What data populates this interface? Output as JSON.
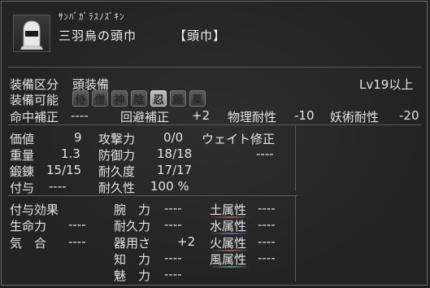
{
  "item": {
    "reading": "ｻﾝﾊﾞｶﾞﾗｽﾉｽﾞｷﾝ",
    "name": "三羽烏の頭巾",
    "category_tag": "【頭巾】",
    "icon": "hood-icon"
  },
  "equip": {
    "slot_label": "装備区分",
    "slot_value": "頭装備",
    "level_req": "Lv19以上",
    "usable_label": "装備可能",
    "classes": [
      {
        "label": "侍",
        "active": false
      },
      {
        "label": "僧",
        "active": false
      },
      {
        "label": "神",
        "active": false
      },
      {
        "label": "陰",
        "active": false
      },
      {
        "label": "忍",
        "active": true
      },
      {
        "label": "鍛",
        "active": false
      },
      {
        "label": "薬",
        "active": false
      }
    ]
  },
  "corrections": {
    "hit_label": "命中補正",
    "hit_value": "----",
    "evade_label": "回避補正",
    "evade_value": "+2",
    "phys_label": "物理耐性",
    "phys_value": "-10",
    "magic_label": "妖術耐性",
    "magic_value": "-20"
  },
  "stats": {
    "price_label": "価値",
    "price_value": "9",
    "weight_label": "重量",
    "weight_value": "1.3",
    "forge_label": "鍛錬",
    "forge_value": "15/15",
    "grant_label": "付与",
    "grant_value": "----",
    "attack_label": "攻撃力",
    "attack_value": "0/0",
    "defense_label": "防御力",
    "defense_value": "18/18",
    "durability_label": "耐久度",
    "durability_value": "17/17",
    "endurance_label": "耐久性",
    "endurance_value": "100 %",
    "weight_mod_label": "ウェイト修正",
    "weight_mod_value": "----"
  },
  "effects": {
    "title": "付与効果",
    "life_label": "生命力",
    "life_value": "----",
    "ki_label": "気　合",
    "ki_value": "----",
    "str_label": "腕　力",
    "str_value": "----",
    "stamina_label": "耐久力",
    "stamina_value": "----",
    "dex_label": "器用さ",
    "dex_value": "+2",
    "int_label": "知　力",
    "int_value": "----",
    "cha_label": "魅　力",
    "cha_value": "----",
    "earth_label": "土属性",
    "earth_value": "----",
    "water_label": "水属性",
    "water_value": "----",
    "fire_label": "火属性",
    "fire_value": "----",
    "wind_label": "風属性",
    "wind_value": "----"
  }
}
